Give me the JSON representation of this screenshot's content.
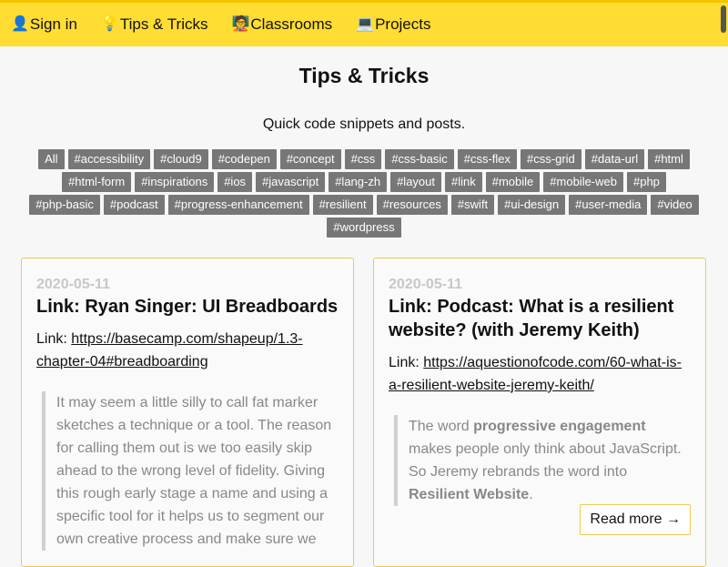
{
  "nav": {
    "items": [
      {
        "icon": "👤",
        "label": "Sign in"
      },
      {
        "icon": "💡",
        "label": "Tips & Tricks"
      },
      {
        "icon": "🧑‍🏫",
        "label": "Classrooms"
      },
      {
        "icon": "💻",
        "label": "Projects"
      }
    ]
  },
  "page": {
    "title": "Tips & Tricks",
    "subtitle": "Quick code snippets and posts."
  },
  "tags": [
    "All",
    "#accessibility",
    "#cloud9",
    "#codepen",
    "#concept",
    "#css",
    "#css-basic",
    "#css-flex",
    "#css-grid",
    "#data-url",
    "#html",
    "#html-form",
    "#inspirations",
    "#ios",
    "#javascript",
    "#lang-zh",
    "#layout",
    "#link",
    "#mobile",
    "#mobile-web",
    "#php",
    "#php-basic",
    "#podcast",
    "#progress-enhancement",
    "#resilient",
    "#resources",
    "#swift",
    "#ui-design",
    "#user-media",
    "#video",
    "#wordpress"
  ],
  "cards": [
    {
      "date": "2020-05-11",
      "title": "Link: Ryan Singer: UI Breadboards",
      "link_prefix": "Link: ",
      "link_text": "https://basecamp.com/shapeup/1.3-chapter-04#breadboarding",
      "quote": "It may seem a little silly to call fat marker sketches a technique or a tool. The reason for calling them out is we too easily skip ahead to the wrong level of fidelity. Giving this rough early stage a name and using a specific tool for it helps us to segment our own creative process and make sure we"
    },
    {
      "date": "2020-05-11",
      "title": "Link: Podcast: What is a resilient website? (with Jeremy Keith)",
      "link_prefix": "Link: ",
      "link_text": "https://aquestionofcode.com/60-what-is-a-resilient-website-jeremy-keith/",
      "quote_parts": [
        "The word ",
        "progressive engagement",
        " makes people only think about JavaScript. So Jeremy rebrands the word into ",
        "Resilient Website",
        "."
      ],
      "read_more": "Read more →"
    }
  ]
}
